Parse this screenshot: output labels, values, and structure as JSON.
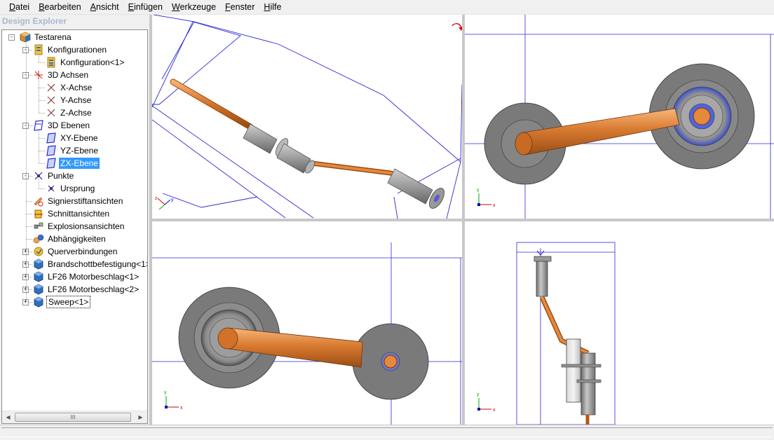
{
  "menu": [
    {
      "label": "Datei",
      "key": "D",
      "rest": "atei"
    },
    {
      "label": "Bearbeiten",
      "key": "B",
      "rest": "earbeiten"
    },
    {
      "label": "Ansicht",
      "key": "A",
      "rest": "nsicht"
    },
    {
      "label": "Einfügen",
      "key": "E",
      "rest": "infügen"
    },
    {
      "label": "Werkzeuge",
      "key": "W",
      "rest": "erkzeuge"
    },
    {
      "label": "Fenster",
      "key": "F",
      "rest": "enster"
    },
    {
      "label": "Hilfe",
      "key": "H",
      "rest": "ilfe"
    }
  ],
  "explorer": {
    "title": "Design Explorer",
    "tree": [
      {
        "label": "Testarena",
        "icon": "assembly-icon",
        "level": 0,
        "expander": "-"
      },
      {
        "label": "Konfigurationen",
        "icon": "configuration-folder-icon",
        "level": 1,
        "expander": "-"
      },
      {
        "label": "Konfiguration<1>",
        "icon": "configuration-icon",
        "level": 2
      },
      {
        "label": "3D Achsen",
        "icon": "axes-icon",
        "level": 1,
        "expander": "-"
      },
      {
        "label": "X-Achse",
        "icon": "axis-icon",
        "level": 2
      },
      {
        "label": "Y-Achse",
        "icon": "axis-icon",
        "level": 2
      },
      {
        "label": "Z-Achse",
        "icon": "axis-icon",
        "level": 2
      },
      {
        "label": "3D Ebenen",
        "icon": "planes-icon",
        "level": 1,
        "expander": "-"
      },
      {
        "label": "XY-Ebene",
        "icon": "plane-icon",
        "level": 2
      },
      {
        "label": "YZ-Ebene",
        "icon": "plane-icon",
        "level": 2
      },
      {
        "label": "ZX-Ebene",
        "icon": "plane-icon",
        "level": 2,
        "selected": true
      },
      {
        "label": "Punkte",
        "icon": "points-icon",
        "level": 1,
        "expander": "-"
      },
      {
        "label": "Ursprung",
        "icon": "point-icon",
        "level": 2
      },
      {
        "label": "Signierstiftansichten",
        "icon": "markup-view-icon",
        "level": 1
      },
      {
        "label": "Schnittansichten",
        "icon": "section-view-icon",
        "level": 1
      },
      {
        "label": "Explosionsansichten",
        "icon": "exploded-view-icon",
        "level": 1
      },
      {
        "label": "Abhängigkeiten",
        "icon": "constraints-icon",
        "level": 1
      },
      {
        "label": "Querverbindungen",
        "icon": "cross-links-icon",
        "level": 1,
        "expander": "+"
      },
      {
        "label": "Brandschottbefestigung<1>",
        "icon": "part-icon",
        "level": 1,
        "expander": "+"
      },
      {
        "label": "LF26 Motorbeschlag<1>",
        "icon": "part-icon",
        "level": 1,
        "expander": "+"
      },
      {
        "label": "LF26 Motorbeschlag<2>",
        "icon": "part-icon",
        "level": 1,
        "expander": "+"
      },
      {
        "label": "Sweep<1>",
        "icon": "part-icon",
        "level": 1,
        "expander": "+",
        "focused": true
      }
    ],
    "scrollbar": {
      "left": "◀",
      "right": "▶",
      "grip": "III"
    }
  },
  "viewports": [
    {
      "name": "isometric",
      "triad": [
        "x",
        "y",
        "z"
      ]
    },
    {
      "name": "top",
      "triad": [
        "x",
        "y"
      ]
    },
    {
      "name": "front",
      "triad": [
        "x",
        "y"
      ]
    },
    {
      "name": "side",
      "triad": [
        "x",
        "y"
      ]
    }
  ],
  "colors": {
    "pipe": "#c8651e",
    "pipe_light": "#f3a25c",
    "steel": "#8a8a8a",
    "plane_line": "#2a2ad6",
    "highlight": "#3399ff",
    "rotate_arrow": "#e00000"
  }
}
